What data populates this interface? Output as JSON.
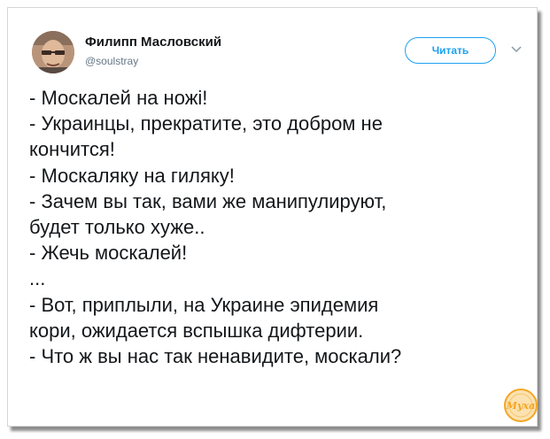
{
  "author": {
    "name": "Филипп Масловский",
    "handle": "@soulstray"
  },
  "follow_button": {
    "label": "Читать"
  },
  "menu_icon": "chevron-down-icon",
  "tweet": {
    "lines": [
      "- Москалей на ножі!",
      "- Украинцы, прекратите, это добром не",
      "кончится!",
      "- Москаляку на гиляку!",
      "- Зачем вы так, вами же манипулируют,",
      "будет только хуже..",
      "- Жечь москалей!",
      "...",
      "- Вот, приплыли, на Украине эпидемия",
      "кори, ожидается вспышка дифтерии.",
      "- Что ж вы нас так ненавидите, москали?"
    ]
  },
  "watermark": {
    "text": "Муха"
  },
  "colors": {
    "accent": "#1da1f2",
    "text": "#14171a",
    "secondary": "#657786",
    "watermark": "#f5a623"
  }
}
